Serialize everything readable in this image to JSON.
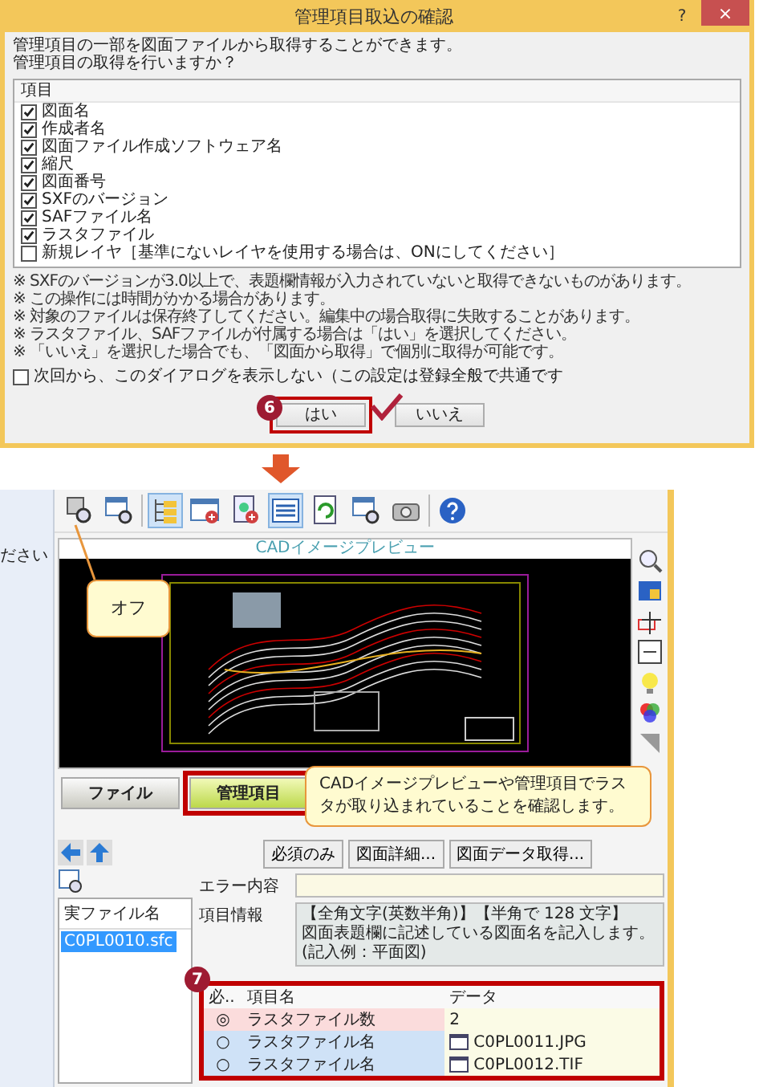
{
  "dialog": {
    "title": "管理項目取込の確認",
    "help": "?",
    "close": "×",
    "message": [
      "管理項目の一部を図面ファイルから取得することができます。",
      "管理項目の取得を行いますか？"
    ],
    "list_header": "項目",
    "items": [
      {
        "label": "図面名",
        "checked": true
      },
      {
        "label": "作成者名",
        "checked": true
      },
      {
        "label": "図面ファイル作成ソフトウェア名",
        "checked": true
      },
      {
        "label": "縮尺",
        "checked": true
      },
      {
        "label": "図面番号",
        "checked": true
      },
      {
        "label": "SXFのバージョン",
        "checked": true
      },
      {
        "label": "SAFファイル名",
        "checked": true
      },
      {
        "label": "ラスタファイル",
        "checked": true
      },
      {
        "label": "新規レイヤ［基準にないレイヤを使用する場合は、ONにしてください］",
        "checked": false
      }
    ],
    "notes": [
      "※ SXFのバージョンが3.0以上で、表題欄情報が入力されていないと取得できないものがあります。",
      "※ この操作には時間がかかる場合があります。",
      "※ 対象のファイルは保存終了してください。編集中の場合取得に失敗することがあります。",
      "※ ラスタファイル、SAFファイルが付属する場合は「はい」を選択してください。",
      "※ 「いいえ」を選択した場合でも、「図面から取得」で個別に取得が可能です。"
    ],
    "dont_show": {
      "label": "次回から、このダイアログを表示しない（この設定は登録全般で共通です",
      "checked": false
    },
    "buttons": [
      {
        "label": "はい",
        "highlighted": true
      },
      {
        "label": "いいえ",
        "highlighted": false
      }
    ],
    "step": "6"
  },
  "app": {
    "left_pane_text": "ださい",
    "toolbar": [
      {
        "kind": "monitor-magnifier",
        "pressed": false
      },
      {
        "kind": "window-magnifier",
        "pressed": false
      },
      {
        "kind": "tree",
        "pressed": true
      },
      {
        "kind": "window-plus",
        "pressed": false
      },
      {
        "kind": "document-plus",
        "pressed": false
      },
      {
        "kind": "list",
        "pressed": true
      },
      {
        "kind": "refresh",
        "pressed": false
      },
      {
        "kind": "window-magnifier",
        "pressed": false
      },
      {
        "kind": "camera",
        "pressed": false
      },
      {
        "kind": "help",
        "pressed": false
      }
    ],
    "toolbar_callout": "オフ",
    "preview_title": "CADイメージプレビュー",
    "tabs": [
      {
        "label": "ファイル",
        "selected": false
      },
      {
        "label": "管理項目",
        "selected": true
      }
    ],
    "action_buttons": [
      "必須のみ",
      "図面詳細...",
      "図面データ取得..."
    ],
    "file_list": {
      "header": "実ファイル名",
      "rows": [
        {
          "name": "C0PL0010.sfc",
          "selected": true
        }
      ]
    },
    "error_label": "エラー内容",
    "info_label": "項目情報",
    "info_text": [
      "【全角文字(英数半角)】【半角で 128 文字】",
      "図面表題欄に記述している図面名を記入します。(記入例：平面図)"
    ],
    "table": {
      "columns": [
        "必..",
        "項目名",
        "データ"
      ],
      "rows": [
        {
          "mark": "◎",
          "name": "ラスタファイル数",
          "data": "2",
          "required": true,
          "kind": "value"
        },
        {
          "mark": "○",
          "name": "ラスタファイル名",
          "data": "C0PL0011.JPG",
          "required": false,
          "kind": "file"
        },
        {
          "mark": "○",
          "name": "ラスタファイル名",
          "data": "C0PL0012.TIF",
          "required": false,
          "kind": "file"
        }
      ]
    },
    "step": "7",
    "callout": "CADイメージプレビューや管理項目でラスタが取り込まれていることを確認します。"
  }
}
